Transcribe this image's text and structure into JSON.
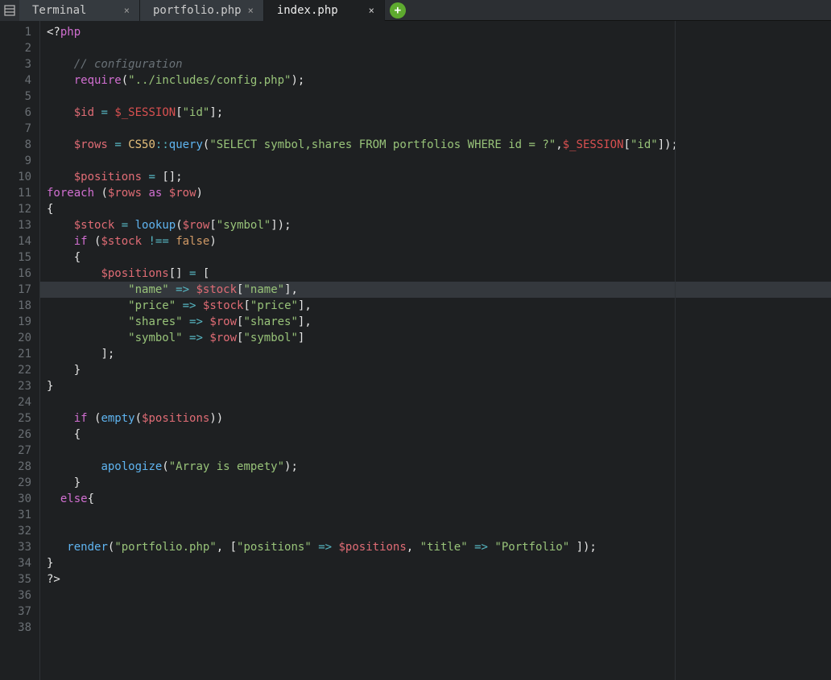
{
  "tabs": [
    {
      "label": "Terminal",
      "active": false
    },
    {
      "label": "portfolio.php",
      "active": false
    },
    {
      "label": "index.php",
      "active": true
    }
  ],
  "editor": {
    "highlighted_line": 17,
    "lines": [
      {
        "num": 1,
        "ind": 0,
        "tokens": [
          [
            "punct",
            "<?"
          ],
          [
            "keyword",
            "php"
          ]
        ]
      },
      {
        "num": 2,
        "ind": 0,
        "tokens": []
      },
      {
        "num": 3,
        "ind": 4,
        "tokens": [
          [
            "comment",
            "// configuration"
          ]
        ]
      },
      {
        "num": 4,
        "ind": 4,
        "tokens": [
          [
            "keyword",
            "require"
          ],
          [
            "punct",
            "("
          ],
          [
            "string",
            "\"../includes/config.php\""
          ],
          [
            "punct",
            ");"
          ]
        ]
      },
      {
        "num": 5,
        "ind": 0,
        "tokens": []
      },
      {
        "num": 6,
        "ind": 4,
        "tokens": [
          [
            "var",
            "$id"
          ],
          [
            "white",
            " "
          ],
          [
            "op",
            "="
          ],
          [
            "white",
            " "
          ],
          [
            "varhl",
            "$_SESSION"
          ],
          [
            "punct",
            "["
          ],
          [
            "string",
            "\"id\""
          ],
          [
            "punct",
            "];"
          ]
        ]
      },
      {
        "num": 7,
        "ind": 0,
        "tokens": []
      },
      {
        "num": 8,
        "ind": 4,
        "tokens": [
          [
            "var",
            "$rows"
          ],
          [
            "white",
            " "
          ],
          [
            "op",
            "="
          ],
          [
            "white",
            " "
          ],
          [
            "class",
            "CS50"
          ],
          [
            "op",
            "::"
          ],
          [
            "func",
            "query"
          ],
          [
            "punct",
            "("
          ],
          [
            "string",
            "\"SELECT symbol,shares FROM portfolios WHERE id = ?\""
          ],
          [
            "punct",
            ","
          ],
          [
            "varhl",
            "$_SESSION"
          ],
          [
            "punct",
            "["
          ],
          [
            "string",
            "\"id\""
          ],
          [
            "punct",
            "]);"
          ]
        ]
      },
      {
        "num": 9,
        "ind": 0,
        "tokens": []
      },
      {
        "num": 10,
        "ind": 4,
        "tokens": [
          [
            "var",
            "$positions"
          ],
          [
            "white",
            " "
          ],
          [
            "op",
            "="
          ],
          [
            "white",
            " "
          ],
          [
            "punct",
            "[];"
          ]
        ]
      },
      {
        "num": 11,
        "ind": 0,
        "tokens": [
          [
            "keyword",
            "foreach"
          ],
          [
            "white",
            " "
          ],
          [
            "punct",
            "("
          ],
          [
            "var",
            "$rows"
          ],
          [
            "white",
            " "
          ],
          [
            "keyword",
            "as"
          ],
          [
            "white",
            " "
          ],
          [
            "var",
            "$row"
          ],
          [
            "punct",
            ")"
          ]
        ]
      },
      {
        "num": 12,
        "ind": 0,
        "tokens": [
          [
            "punct",
            "{"
          ]
        ]
      },
      {
        "num": 13,
        "ind": 4,
        "tokens": [
          [
            "var",
            "$stock"
          ],
          [
            "white",
            " "
          ],
          [
            "op",
            "="
          ],
          [
            "white",
            " "
          ],
          [
            "func",
            "lookup"
          ],
          [
            "punct",
            "("
          ],
          [
            "var",
            "$row"
          ],
          [
            "punct",
            "["
          ],
          [
            "string",
            "\"symbol\""
          ],
          [
            "punct",
            "]);"
          ]
        ]
      },
      {
        "num": 14,
        "ind": 4,
        "tokens": [
          [
            "keyword",
            "if"
          ],
          [
            "white",
            " "
          ],
          [
            "punct",
            "("
          ],
          [
            "var",
            "$stock"
          ],
          [
            "white",
            " "
          ],
          [
            "op",
            "!=="
          ],
          [
            "white",
            " "
          ],
          [
            "bool",
            "false"
          ],
          [
            "punct",
            ")"
          ]
        ]
      },
      {
        "num": 15,
        "ind": 4,
        "tokens": [
          [
            "punct",
            "{"
          ]
        ]
      },
      {
        "num": 16,
        "ind": 8,
        "tokens": [
          [
            "var",
            "$positions"
          ],
          [
            "punct",
            "[]"
          ],
          [
            "white",
            " "
          ],
          [
            "op",
            "="
          ],
          [
            "white",
            " "
          ],
          [
            "punct",
            "["
          ]
        ]
      },
      {
        "num": 17,
        "ind": 12,
        "tokens": [
          [
            "string",
            "\"name\""
          ],
          [
            "white",
            " "
          ],
          [
            "op",
            "=>"
          ],
          [
            "white",
            " "
          ],
          [
            "var",
            "$stock"
          ],
          [
            "punct",
            "["
          ],
          [
            "string",
            "\"name\""
          ],
          [
            "punct",
            "],"
          ]
        ]
      },
      {
        "num": 18,
        "ind": 12,
        "tokens": [
          [
            "string",
            "\"price\""
          ],
          [
            "white",
            " "
          ],
          [
            "op",
            "=>"
          ],
          [
            "white",
            " "
          ],
          [
            "var",
            "$stock"
          ],
          [
            "punct",
            "["
          ],
          [
            "string",
            "\"price\""
          ],
          [
            "punct",
            "],"
          ]
        ]
      },
      {
        "num": 19,
        "ind": 12,
        "tokens": [
          [
            "string",
            "\"shares\""
          ],
          [
            "white",
            " "
          ],
          [
            "op",
            "=>"
          ],
          [
            "white",
            " "
          ],
          [
            "var",
            "$row"
          ],
          [
            "punct",
            "["
          ],
          [
            "string",
            "\"shares\""
          ],
          [
            "punct",
            "],"
          ]
        ]
      },
      {
        "num": 20,
        "ind": 12,
        "tokens": [
          [
            "string",
            "\"symbol\""
          ],
          [
            "white",
            " "
          ],
          [
            "op",
            "=>"
          ],
          [
            "white",
            " "
          ],
          [
            "var",
            "$row"
          ],
          [
            "punct",
            "["
          ],
          [
            "string",
            "\"symbol\""
          ],
          [
            "punct",
            "]"
          ]
        ]
      },
      {
        "num": 21,
        "ind": 8,
        "tokens": [
          [
            "punct",
            "];"
          ]
        ]
      },
      {
        "num": 22,
        "ind": 4,
        "tokens": [
          [
            "punct",
            "}"
          ]
        ]
      },
      {
        "num": 23,
        "ind": 0,
        "tokens": [
          [
            "punct",
            "}"
          ]
        ]
      },
      {
        "num": 24,
        "ind": 0,
        "tokens": []
      },
      {
        "num": 25,
        "ind": 4,
        "tokens": [
          [
            "keyword",
            "if"
          ],
          [
            "white",
            " "
          ],
          [
            "punct",
            "("
          ],
          [
            "func",
            "empty"
          ],
          [
            "punct",
            "("
          ],
          [
            "var",
            "$positions"
          ],
          [
            "punct",
            "))"
          ]
        ]
      },
      {
        "num": 26,
        "ind": 4,
        "tokens": [
          [
            "punct",
            "{"
          ]
        ]
      },
      {
        "num": 27,
        "ind": 0,
        "tokens": []
      },
      {
        "num": 28,
        "ind": 8,
        "tokens": [
          [
            "func",
            "apologize"
          ],
          [
            "punct",
            "("
          ],
          [
            "string",
            "\"Array is empety\""
          ],
          [
            "punct",
            ");"
          ]
        ]
      },
      {
        "num": 29,
        "ind": 4,
        "tokens": [
          [
            "punct",
            "}"
          ]
        ]
      },
      {
        "num": 30,
        "ind": 2,
        "tokens": [
          [
            "keyword",
            "else"
          ],
          [
            "punct",
            "{"
          ]
        ]
      },
      {
        "num": 31,
        "ind": 0,
        "tokens": []
      },
      {
        "num": 32,
        "ind": 0,
        "tokens": []
      },
      {
        "num": 33,
        "ind": 3,
        "tokens": [
          [
            "func",
            "render"
          ],
          [
            "punct",
            "("
          ],
          [
            "string",
            "\"portfolio.php\""
          ],
          [
            "punct",
            ", ["
          ],
          [
            "string",
            "\"positions\""
          ],
          [
            "white",
            " "
          ],
          [
            "op",
            "=>"
          ],
          [
            "white",
            " "
          ],
          [
            "var",
            "$positions"
          ],
          [
            "punct",
            ", "
          ],
          [
            "string",
            "\"title\""
          ],
          [
            "white",
            " "
          ],
          [
            "op",
            "=>"
          ],
          [
            "white",
            " "
          ],
          [
            "string",
            "\"Portfolio\""
          ],
          [
            "white",
            " "
          ],
          [
            "punct",
            "]);"
          ]
        ]
      },
      {
        "num": 34,
        "ind": 0,
        "tokens": [
          [
            "punct",
            "}"
          ]
        ]
      },
      {
        "num": 35,
        "ind": 0,
        "tokens": [
          [
            "punct",
            "?>"
          ]
        ]
      },
      {
        "num": 36,
        "ind": 0,
        "tokens": []
      },
      {
        "num": 37,
        "ind": 0,
        "tokens": []
      },
      {
        "num": 38,
        "ind": 0,
        "tokens": []
      }
    ]
  }
}
